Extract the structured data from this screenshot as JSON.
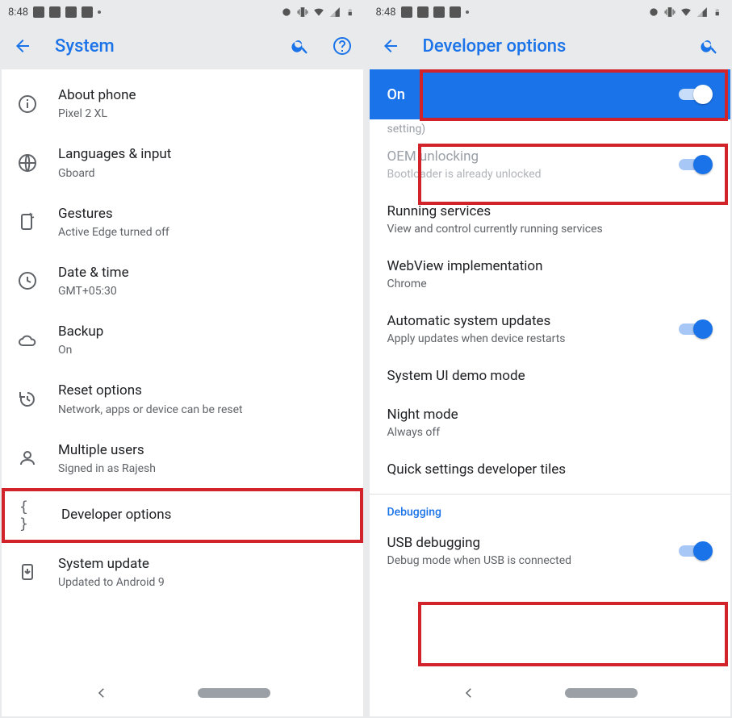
{
  "status": {
    "time": "8:48"
  },
  "left": {
    "title": "System",
    "items": [
      {
        "icon": "info",
        "primary": "About phone",
        "secondary": "Pixel 2 XL"
      },
      {
        "icon": "globe",
        "primary": "Languages & input",
        "secondary": "Gboard"
      },
      {
        "icon": "gesture",
        "primary": "Gestures",
        "secondary": "Active Edge turned off"
      },
      {
        "icon": "clock",
        "primary": "Date & time",
        "secondary": "GMT+05:30"
      },
      {
        "icon": "cloud",
        "primary": "Backup",
        "secondary": "On"
      },
      {
        "icon": "restore",
        "primary": "Reset options",
        "secondary": "Network, apps or device can be reset"
      },
      {
        "icon": "person",
        "primary": "Multiple users",
        "secondary": "Signed in as Rajesh"
      },
      {
        "icon": "braces",
        "primary": "Developer options",
        "secondary": ""
      },
      {
        "icon": "update",
        "primary": "System update",
        "secondary": "Updated to Android 9"
      }
    ]
  },
  "right": {
    "title": "Developer options",
    "on_label": "On",
    "peek": "setting)",
    "items": {
      "oem": {
        "primary": "OEM unlocking",
        "secondary": "Bootloader is already unlocked"
      },
      "running": {
        "primary": "Running services",
        "secondary": "View and control currently running services"
      },
      "webview": {
        "primary": "WebView implementation",
        "secondary": "Chrome"
      },
      "auto_update": {
        "primary": "Automatic system updates",
        "secondary": "Apply updates when device restarts"
      },
      "demo": {
        "primary": "System UI demo mode"
      },
      "night": {
        "primary": "Night mode",
        "secondary": "Always off"
      },
      "qs": {
        "primary": "Quick settings developer tiles"
      }
    },
    "debug_label": "Debugging",
    "usb": {
      "primary": "USB debugging",
      "secondary": "Debug mode when USB is connected"
    }
  }
}
